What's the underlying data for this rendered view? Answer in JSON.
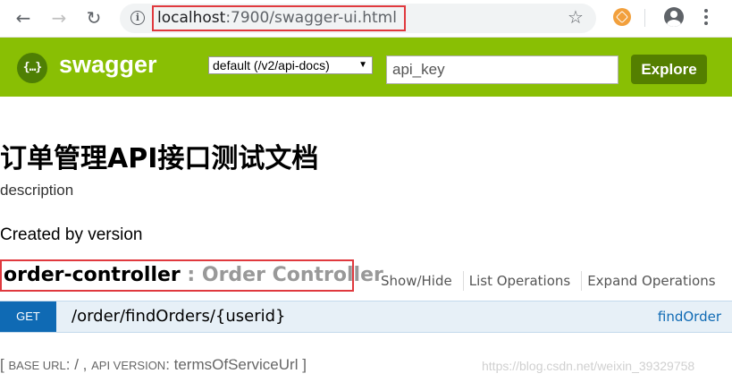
{
  "browser": {
    "back_glyph": "←",
    "forward_glyph": "→",
    "reload_glyph": "↻",
    "info_glyph": "i",
    "url_host": "localhost",
    "url_path": ":7900/swagger-ui.html",
    "star_glyph": "☆"
  },
  "header": {
    "logo_glyph": "{…}",
    "logo_text": "swagger",
    "spec_select_value": "default (/v2/api-docs)",
    "select_arrow": "▼",
    "api_key_placeholder": "api_key",
    "explore_label": "Explore",
    "brand_color": "#89bf04"
  },
  "info": {
    "title": "订单管理API接口测试文档",
    "description": "description",
    "created_by": "Created by version"
  },
  "controller": {
    "name": "order-controller",
    "description": " : Order Controller",
    "show_hide": "Show/Hide",
    "list_operations": "List Operations",
    "expand_operations": "Expand Operations"
  },
  "operation": {
    "method": "GET",
    "path": "/order/findOrders/{userid}",
    "nickname": "findOrder",
    "method_color": "#0f6ab4"
  },
  "footer": {
    "open": "[ ",
    "base_url_label": "BASE URL",
    "base_url_value": ": / , ",
    "api_version_label": "API VERSION",
    "api_version_value": ": termsOfServiceUrl ]"
  },
  "watermark": "https://blog.csdn.net/weixin_39329758"
}
